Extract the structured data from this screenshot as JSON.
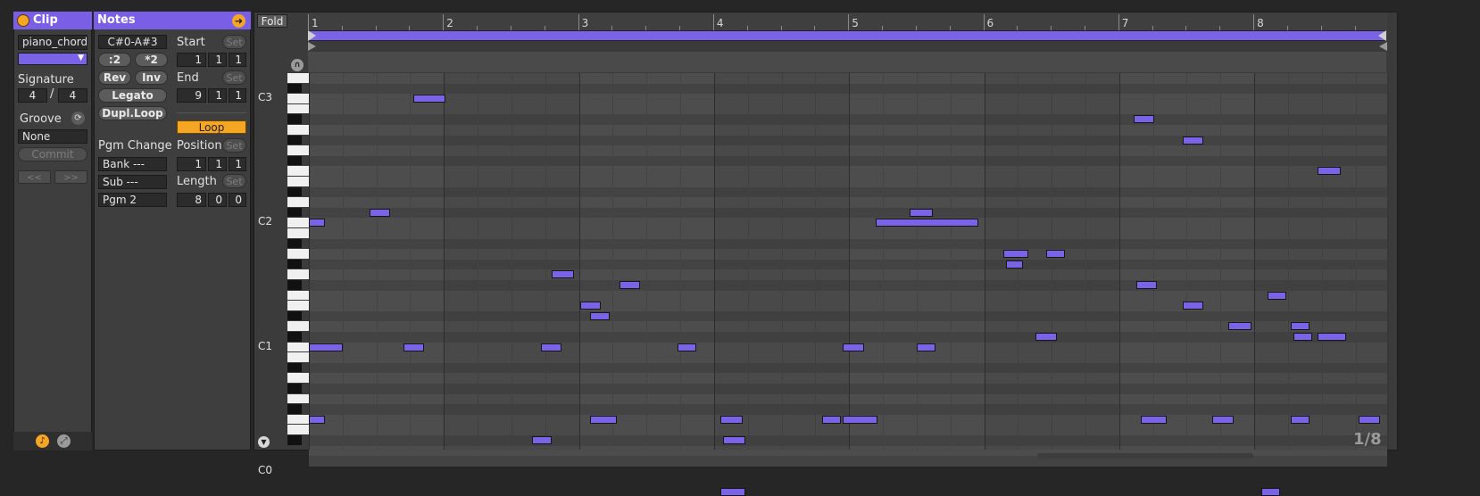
{
  "clip_panel": {
    "title": "Clip",
    "clip_name": "piano_chords",
    "signature_label": "Signature",
    "sig_num": "4",
    "sig_sep": "/",
    "sig_den": "4",
    "groove_label": "Groove",
    "groove_value": "None",
    "commit_label": "Commit",
    "prev_label": "<<",
    "next_label": ">>",
    "colors": {
      "header": "#7a5fe6",
      "clip_color": "#7b63e8"
    }
  },
  "notes_panel": {
    "title": "Notes",
    "range": "C#0-A#3",
    "half_label": ":2",
    "double_label": "*2",
    "rev_label": "Rev",
    "inv_label": "Inv",
    "legato_label": "Legato",
    "dupl_loop_label": "Dupl.Loop",
    "start_label": "Start",
    "end_label": "End",
    "set_label": "Set",
    "loop_label": "Loop",
    "position_label": "Position",
    "length_label": "Length",
    "pgm_change_label": "Pgm Change",
    "bank": "Bank ---",
    "sub": "Sub ---",
    "pgm": "Pgm 2",
    "start": [
      "1",
      "1",
      "1"
    ],
    "end": [
      "9",
      "1",
      "1"
    ],
    "position": [
      "1",
      "1",
      "1"
    ],
    "length": [
      "8",
      "0",
      "0"
    ]
  },
  "editor": {
    "fold_label": "Fold",
    "grid_label": "1/8",
    "bars": [
      "1",
      "2",
      "3",
      "4",
      "5",
      "6",
      "7",
      "8"
    ],
    "octaves": [
      "C3",
      "C2",
      "C1",
      "C0"
    ],
    "note_color": "#7b63e8",
    "loop_color": "#7b63e8"
  },
  "notes": [
    {
      "bar": 1.0,
      "len": 0.12,
      "pitch": 29
    },
    {
      "bar": 1.0,
      "len": 0.25,
      "pitch": 36
    },
    {
      "bar": 1.0,
      "len": 0.12,
      "pitch": 48
    },
    {
      "bar": 1.45,
      "len": 0.15,
      "pitch": 49
    },
    {
      "bar": 1.7,
      "len": 0.15,
      "pitch": 36
    },
    {
      "bar": 1.77,
      "len": 0.24,
      "pitch": 60
    },
    {
      "bar": 2.65,
      "len": 0.15,
      "pitch": 27
    },
    {
      "bar": 2.72,
      "len": 0.15,
      "pitch": 36
    },
    {
      "bar": 2.8,
      "len": 0.16,
      "pitch": 43
    },
    {
      "bar": 3.01,
      "len": 0.15,
      "pitch": 40
    },
    {
      "bar": 3.08,
      "len": 0.15,
      "pitch": 39
    },
    {
      "bar": 3.08,
      "len": 0.2,
      "pitch": 29
    },
    {
      "bar": 3.3,
      "len": 0.15,
      "pitch": 42
    },
    {
      "bar": 3.73,
      "len": 0.14,
      "pitch": 36
    },
    {
      "bar": 4.05,
      "len": 0.16,
      "pitch": 29
    },
    {
      "bar": 4.07,
      "len": 0.16,
      "pitch": 27
    },
    {
      "bar": 4.05,
      "len": 0.18,
      "pitch": 22
    },
    {
      "bar": 4.8,
      "len": 0.14,
      "pitch": 29
    },
    {
      "bar": 4.95,
      "len": 0.26,
      "pitch": 29
    },
    {
      "bar": 4.95,
      "len": 0.16,
      "pitch": 36
    },
    {
      "bar": 5.2,
      "len": 0.76,
      "pitch": 48
    },
    {
      "bar": 5.45,
      "len": 0.17,
      "pitch": 49
    },
    {
      "bar": 5.5,
      "len": 0.14,
      "pitch": 36
    },
    {
      "bar": 6.14,
      "len": 0.19,
      "pitch": 45
    },
    {
      "bar": 6.16,
      "len": 0.13,
      "pitch": 44
    },
    {
      "bar": 6.38,
      "len": 0.16,
      "pitch": 37
    },
    {
      "bar": 6.46,
      "len": 0.14,
      "pitch": 45
    },
    {
      "bar": 7.11,
      "len": 0.15,
      "pitch": 58
    },
    {
      "bar": 7.13,
      "len": 0.15,
      "pitch": 42
    },
    {
      "bar": 7.16,
      "len": 0.19,
      "pitch": 29
    },
    {
      "bar": 7.47,
      "len": 0.15,
      "pitch": 56
    },
    {
      "bar": 7.47,
      "len": 0.15,
      "pitch": 40
    },
    {
      "bar": 7.69,
      "len": 0.16,
      "pitch": 29
    },
    {
      "bar": 7.81,
      "len": 0.17,
      "pitch": 38
    },
    {
      "bar": 8.05,
      "len": 0.14,
      "pitch": 22
    },
    {
      "bar": 8.1,
      "len": 0.14,
      "pitch": 41
    },
    {
      "bar": 8.27,
      "len": 0.14,
      "pitch": 29
    },
    {
      "bar": 8.27,
      "len": 0.14,
      "pitch": 38
    },
    {
      "bar": 8.29,
      "len": 0.14,
      "pitch": 37
    },
    {
      "bar": 8.47,
      "len": 0.21,
      "pitch": 37
    },
    {
      "bar": 8.47,
      "len": 0.17,
      "pitch": 53
    },
    {
      "bar": 8.77,
      "len": 0.16,
      "pitch": 29
    }
  ]
}
